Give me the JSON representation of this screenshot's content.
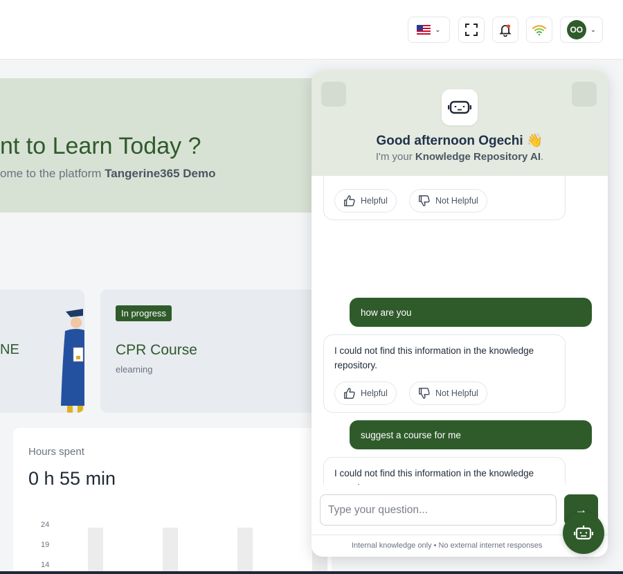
{
  "topbar": {
    "language_icon": "us-flag-icon",
    "chevron": "⌄",
    "avatar_initials": "OO"
  },
  "hero": {
    "title": "nt to Learn Today ?",
    "subtitle_prefix": "ome to the platform ",
    "subtitle_bold": "Tangerine365 Demo"
  },
  "cards": {
    "partial_title": "NE",
    "course": {
      "badge": "In progress",
      "title": "CPR Course",
      "type": "elearning"
    }
  },
  "hours": {
    "label": "Hours spent",
    "value": "0 h 55 min",
    "ticks": [
      "24",
      "19",
      "14"
    ]
  },
  "chat": {
    "greeting": "Good afternoon Ogechi 👋",
    "sub_prefix": "I'm your ",
    "sub_bold": "Knowledge Repository AI",
    "sub_suffix": ".",
    "feedback": {
      "helpful": "Helpful",
      "not_helpful": "Not Helpful"
    },
    "messages": [
      {
        "role": "user",
        "text": "how are you"
      },
      {
        "role": "bot",
        "text": "I could not find this information in the knowledge repository."
      },
      {
        "role": "user",
        "text": "suggest a course for me"
      },
      {
        "role": "bot",
        "text": "I could not find this information in the knowledge repository."
      }
    ],
    "input_placeholder": "Type your question...",
    "send_label": "→",
    "footer_note": "Internal knowledge only • No external internet responses"
  }
}
